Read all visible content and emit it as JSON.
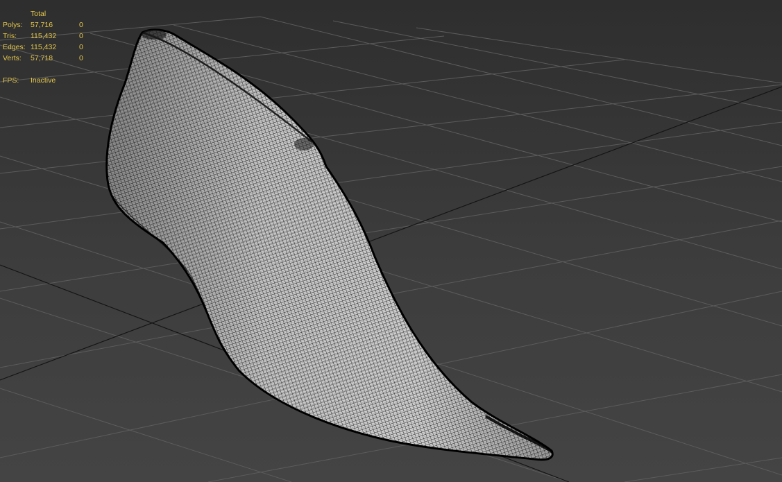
{
  "viewport": {
    "name": "perspective-viewport",
    "background_color": "#3a3a3a",
    "grid_color": "#5a5a5a",
    "axis_color": "#111111",
    "mesh_display": "wireframe",
    "mesh_color": "#000000",
    "mesh_fill_color": "#c9c9c9"
  },
  "stats": {
    "text_color": "#e6c84a",
    "header_total": "Total",
    "rows": [
      {
        "label": "Polys:",
        "total": "57,716",
        "selected": "0"
      },
      {
        "label": "Tris:",
        "total": "115,432",
        "selected": "0"
      },
      {
        "label": "Edges:",
        "total": "115,432",
        "selected": "0"
      },
      {
        "label": "Verts:",
        "total": "57,718",
        "selected": "0"
      }
    ],
    "fps_label": "FPS:",
    "fps_value": "Inactive"
  }
}
